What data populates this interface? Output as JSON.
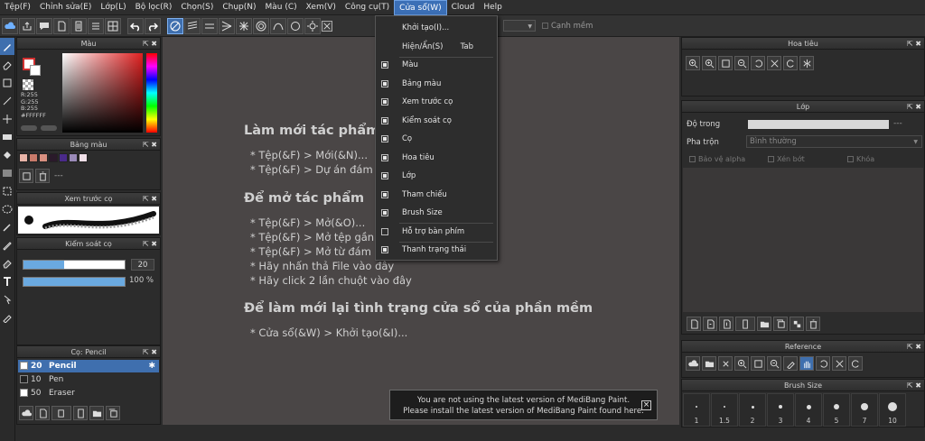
{
  "menubar": {
    "items": [
      "Tệp(F)",
      "Chỉnh sửa(E)",
      "Lớp(L)",
      "Bộ lọc(R)",
      "Chọn(S)",
      "Chụp(N)",
      "Màu (C)",
      "Xem(V)",
      "Công cụ(T)",
      "Cửa sổ(W)",
      "Cloud",
      "Help"
    ],
    "active": "Cửa sổ(W)"
  },
  "toolbar": {
    "antialias_label": "Cạnh mềm"
  },
  "color_panel": {
    "title": "Màu",
    "rgb_r": "R:255",
    "rgb_g": "G:255",
    "rgb_b": "B:255",
    "hex": "#FFFFFF"
  },
  "palette_panel": {
    "title": "Bảng màu",
    "dash": "---",
    "swatches": [
      "#e8b4a8",
      "#c87a6a",
      "#d89080",
      "#2a1a2a",
      "#4a2a8a",
      "#9a8ab8",
      "#f0e0e8"
    ]
  },
  "brush_preview_panel": {
    "title": "Xem trước cọ"
  },
  "brush_control_panel": {
    "title": "Kiểm soát cọ",
    "size_value": "20",
    "opacity_value": "100 %"
  },
  "brush_list_panel": {
    "title": "Cọ: Pencil",
    "items": [
      {
        "size": "20",
        "name": "Pencil"
      },
      {
        "size": "10",
        "name": "Pen"
      },
      {
        "size": "50",
        "name": "Eraser"
      }
    ]
  },
  "welcome": {
    "h1": "Làm mới tác phẩm",
    "l1": "* Tệp(&F) > Mới(&N)...",
    "l2": "* Tệp(&F) > Dự án đám",
    "h2": "Để mở tác phẩm",
    "l3": "* Tệp(&F) > Mở(&O)...",
    "l4": "* Tệp(&F) > Mở tệp gần",
    "l5": "* Tệp(&F) > Mở từ đám",
    "l6": "* Hãy nhấn thả File vào đây",
    "l7": "* Hãy click 2 lần chuột vào đây",
    "h3": "Để làm mới lại tình trạng cửa sổ của phần mềm",
    "l8": "* Cửa sổ(&W) > Khởi tạo(&I)..."
  },
  "dropdown": {
    "items": [
      {
        "label": "Khởi tạo(I)...",
        "check": "none",
        "shortcut": ""
      },
      {
        "label": "Hiện/Ẩn(S)",
        "check": "none",
        "shortcut": "Tab"
      },
      {
        "label": "Màu",
        "check": "on",
        "shortcut": ""
      },
      {
        "label": "Bảng màu",
        "check": "on",
        "shortcut": ""
      },
      {
        "label": "Xem trước cọ",
        "check": "on",
        "shortcut": ""
      },
      {
        "label": "Kiểm soát cọ",
        "check": "on",
        "shortcut": ""
      },
      {
        "label": "Cọ",
        "check": "on",
        "shortcut": ""
      },
      {
        "label": "Hoa tiêu",
        "check": "on",
        "shortcut": ""
      },
      {
        "label": "Lớp",
        "check": "on",
        "shortcut": ""
      },
      {
        "label": "Tham chiếu",
        "check": "on",
        "shortcut": ""
      },
      {
        "label": "Brush Size",
        "check": "on",
        "shortcut": ""
      },
      {
        "label": "Hỗ trợ bàn phím",
        "check": "off",
        "shortcut": ""
      },
      {
        "label": "Thanh trạng thái",
        "check": "on",
        "shortcut": ""
      }
    ]
  },
  "navigator_panel": {
    "title": "Hoa tiêu"
  },
  "layer_panel": {
    "title": "Lớp",
    "opacity_label": "Độ trong",
    "opacity_value": "---",
    "blend_label": "Pha trộn",
    "blend_value": "Bình thường",
    "protect_alpha": "Bảo vệ alpha",
    "clipping": "Xén bớt",
    "lock": "Khóa"
  },
  "reference_panel": {
    "title": "Reference"
  },
  "brush_size_panel": {
    "title": "Brush Size",
    "sizes": [
      "1",
      "1.5",
      "2",
      "3",
      "4",
      "5",
      "7",
      "10"
    ]
  },
  "notification": {
    "line1": "You are not using the latest version of MediBang Paint.",
    "line2": "Please install the latest version of MediBang Paint found here."
  },
  "colors": {
    "accent": "#3f6fae",
    "canvas_bg": "#4a4646",
    "panel_bg": "#2c2c2c"
  }
}
